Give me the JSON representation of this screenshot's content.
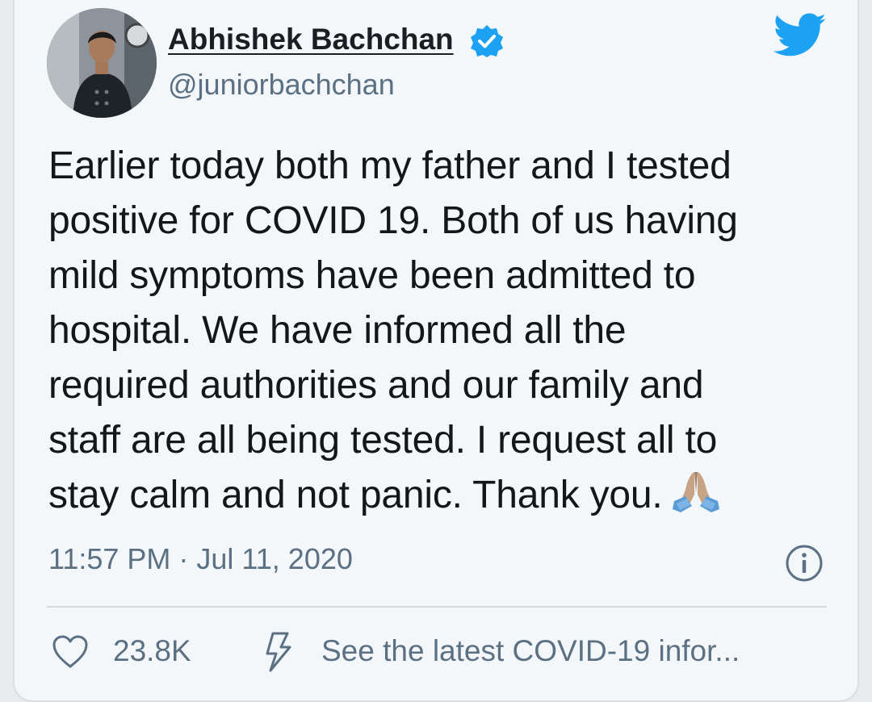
{
  "author": {
    "display_name": "Abhishek Bachchan",
    "handle": "@juniorbachchan",
    "verified": true
  },
  "tweet": {
    "lines": [
      "Earlier today both my father and I tested",
      "positive for COVID 19. Both of us having",
      "mild symptoms have been admitted to",
      "hospital. We have informed all the",
      "required authorities and our family and",
      "staff are all being tested. I request all to",
      "stay calm and not panic. Thank you."
    ],
    "emoji": "folded-hands-emoji",
    "timestamp": "11:57 PM · Jul 11, 2020"
  },
  "actions": {
    "like_count": "23.8K",
    "covid_link": "See the latest COVID-19 infor..."
  },
  "icons": {
    "verified": "verified-badge-icon",
    "brand": "twitter-bird-icon",
    "info": "info-icon",
    "like": "heart-icon",
    "covid": "lightning-bolt-icon"
  },
  "colors": {
    "twitter_blue": "#1da1f2",
    "text_primary": "#14171a",
    "text_secondary": "#5b7083",
    "card_background": "#f4f7f9"
  }
}
